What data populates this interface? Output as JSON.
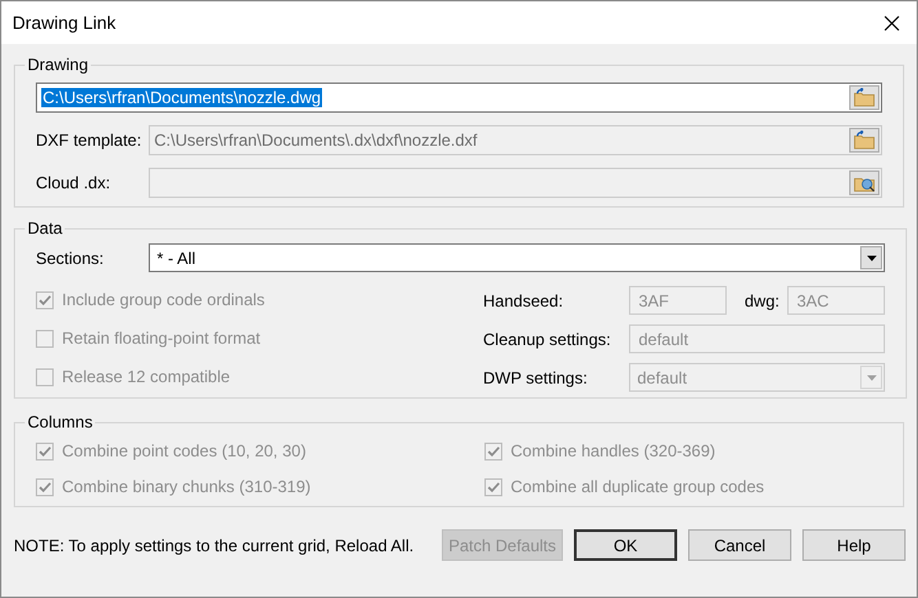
{
  "window": {
    "title": "Drawing Link"
  },
  "drawing": {
    "legend": "Drawing",
    "fields": [
      {
        "kind": "path",
        "value": "C:\\Users\\rfran\\Documents\\nozzle.dwg",
        "selected": true,
        "disabled": false
      },
      {
        "kind": "template",
        "label": "DXF template:",
        "value": "C:\\Users\\rfran\\Documents\\.dx\\dxf\\nozzle.dxf",
        "selected": false,
        "disabled": true
      },
      {
        "kind": "cloud",
        "label": "Cloud .dx:",
        "disabled": true
      }
    ]
  },
  "data": {
    "legend": "Data",
    "sections": {
      "label": "Sections:",
      "value": "* - All"
    },
    "options": [
      {
        "label": "Include group code ordinals",
        "checked": true,
        "disabled": true
      },
      {
        "label": "Retain floating-point format",
        "checked": false,
        "disabled": true
      },
      {
        "label": "Release 12 compatible",
        "checked": false,
        "disabled": true
      }
    ],
    "handseed": {
      "label": "Handseed:",
      "value": "3AF"
    },
    "dwg": {
      "label": "dwg:",
      "value": "3AC"
    },
    "cleanup": {
      "label": "Cleanup settings:",
      "value": "default"
    },
    "dwp": {
      "label": "DWP settings:",
      "value": "default"
    }
  },
  "columns": {
    "legend": "Columns",
    "options": [
      {
        "label": "Combine point codes (10, 20, 30)",
        "checked": true,
        "disabled": true
      },
      {
        "label": "Combine handles (320-369)",
        "checked": true,
        "disabled": true
      },
      {
        "label": "Combine binary chunks (310-319)",
        "checked": true,
        "disabled": true
      },
      {
        "label": "Combine all duplicate group codes",
        "checked": true,
        "disabled": true
      }
    ]
  },
  "note": "NOTE: To apply settings to the current grid, Reload All.",
  "buttons": [
    {
      "label": "Patch Defaults",
      "disabled": true,
      "default": false
    },
    {
      "label": "OK",
      "disabled": false,
      "default": true
    },
    {
      "label": "Cancel",
      "disabled": false,
      "default": false
    },
    {
      "label": "Help",
      "disabled": false,
      "default": false
    }
  ]
}
